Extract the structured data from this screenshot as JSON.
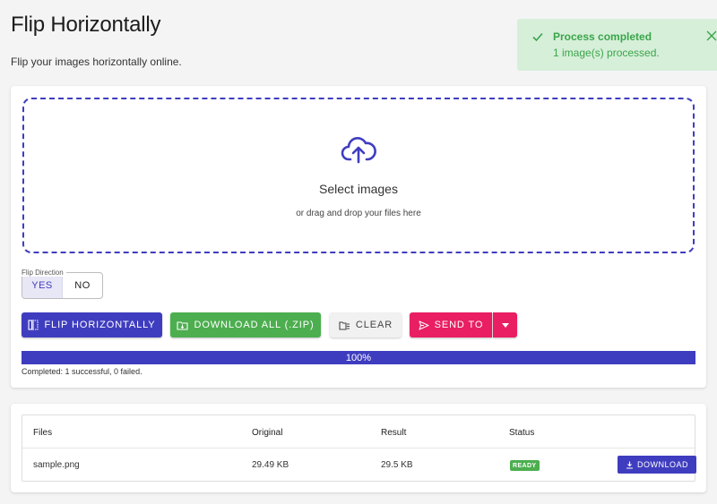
{
  "header": {
    "title": "Flip Horizontally",
    "subtitle": "Flip your images horizontally online."
  },
  "toast": {
    "title": "Process completed",
    "message": "1 image(s) processed.",
    "color": "#3aa54a"
  },
  "dropzone": {
    "title": "Select images",
    "subtitle": "or drag and drop your files here"
  },
  "flip_direction": {
    "legend": "Flip Direction",
    "options": [
      "YES",
      "NO"
    ],
    "selected": "YES"
  },
  "actions": {
    "flip_label": "FLIP HORIZONTALLY",
    "download_all_label": "DOWNLOAD ALL (.ZIP)",
    "clear_label": "CLEAR",
    "send_to_label": "SEND TO"
  },
  "progress": {
    "value": 100,
    "label": "100%",
    "status": "Completed: 1 successful, 0 failed."
  },
  "table": {
    "columns": [
      "Files",
      "Original",
      "Result",
      "Status"
    ],
    "rows": [
      {
        "file": "sample.png",
        "original": "29.49 KB",
        "result": "29.5 KB",
        "status": "READY",
        "action": "DOWNLOAD"
      }
    ]
  },
  "colors": {
    "primary": "#3f3dbf",
    "success": "#4cae4f",
    "accent": "#e91e63"
  }
}
